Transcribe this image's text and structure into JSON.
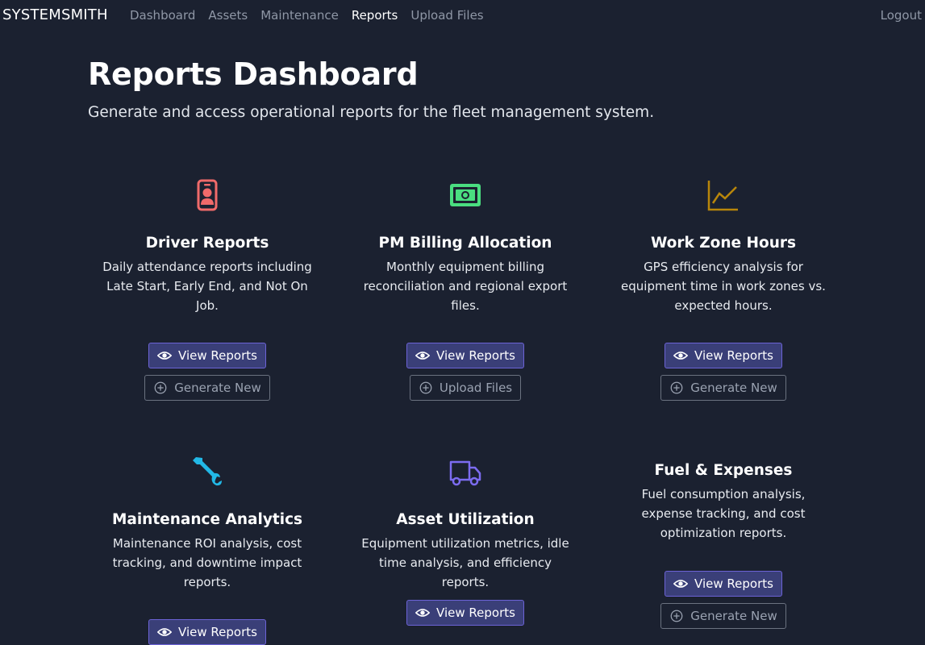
{
  "nav": {
    "brand": "SYSTEMSMITH",
    "links": [
      "Dashboard",
      "Assets",
      "Maintenance",
      "Reports",
      "Upload Files"
    ],
    "active": "Reports",
    "logout": "Logout"
  },
  "header": {
    "title": "Reports Dashboard",
    "subtitle": "Generate and access operational reports for the fleet management system."
  },
  "colors": {
    "driver_icon": "#f06a6a",
    "billing_icon": "#4ade80",
    "workzone_icon": "#b8860b",
    "maintenance_icon": "#22b8e6",
    "asset_icon": "#7c6cf0"
  },
  "cards": [
    {
      "icon": "id-badge-icon",
      "title": "Driver Reports",
      "description": "Daily attendance reports including Late Start, Early End, and Not On Job.",
      "primary": "View Reports",
      "secondary": "Generate New"
    },
    {
      "icon": "money-bill-icon",
      "title": "PM Billing Allocation",
      "description": "Monthly equipment billing reconciliation and regional export files.",
      "primary": "View Reports",
      "secondary": "Upload Files"
    },
    {
      "icon": "line-chart-icon",
      "title": "Work Zone Hours",
      "description": "GPS efficiency analysis for equipment time in work zones vs. expected hours.",
      "primary": "View Reports",
      "secondary": "Generate New"
    },
    {
      "icon": "wrench-icon",
      "title": "Maintenance Analytics",
      "description": "Maintenance ROI analysis, cost tracking, and downtime impact reports.",
      "primary": "View Reports"
    },
    {
      "icon": "truck-icon",
      "title": "Asset Utilization",
      "description": "Equipment utilization metrics, idle time analysis, and efficiency reports.",
      "primary": "View Reports"
    },
    {
      "title": "Fuel & Expenses",
      "description": "Fuel consumption analysis, expense tracking, and cost optimization reports.",
      "primary": "View Reports",
      "secondary": "Generate New"
    }
  ]
}
